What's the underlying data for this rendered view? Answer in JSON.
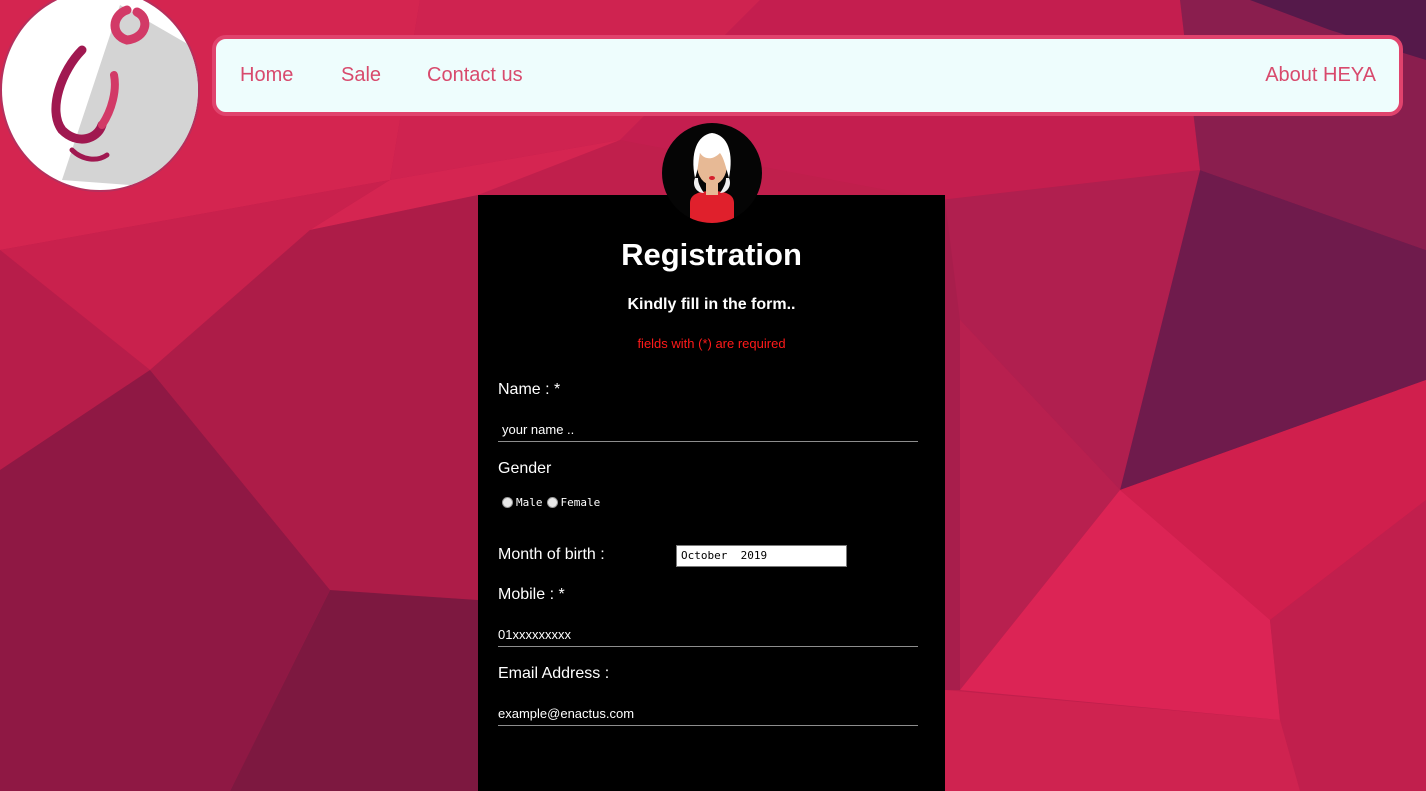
{
  "nav": {
    "home": "Home",
    "sale": "Sale",
    "contact": "Contact us",
    "about": "About HEYA"
  },
  "logo": {
    "name": "heya-logo"
  },
  "form": {
    "title": "Registration",
    "subtitle": "Kindly fill in the form..",
    "required_note": "fields with (*) are required",
    "name_label": "Name : *",
    "name_placeholder": "your name ..",
    "gender_label": "Gender",
    "gender_options": [
      "Male",
      "Female"
    ],
    "birth_label": "Month of birth :",
    "birth_value": "October  2019",
    "mobile_label": "Mobile : *",
    "mobile_placeholder": "01xxxxxxxxx",
    "email_label": "Email Address :",
    "email_placeholder": "example@enactus.com"
  },
  "colors": {
    "accent": "#e0436d",
    "nav_bg": "#eefdfd",
    "nav_text": "#d84a6d",
    "required": "#ff1a1a",
    "panel": "#000000"
  }
}
